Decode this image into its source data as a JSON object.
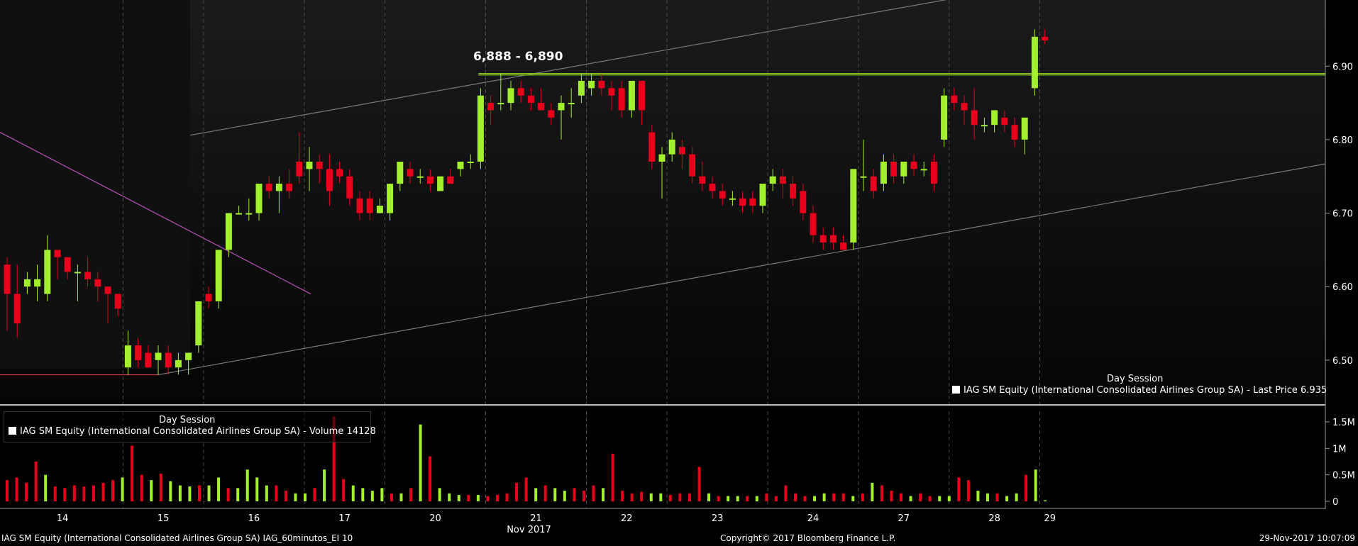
{
  "chart_data": [
    {
      "type": "candlestick",
      "name": "IAG SM Equity (International Consolidated Airlines Group SA) - Last Price 6.935",
      "session_label": "Day Session",
      "ylim": [
        6.44,
        6.99
      ],
      "yticks": [
        "6.50",
        "6.60",
        "6.70",
        "6.80",
        "6.90"
      ],
      "annotation": "6,888 - 6,890",
      "levels": [
        6.888,
        6.89
      ],
      "support": 6.48,
      "candles": [
        [
          6.63,
          6.64,
          6.54,
          6.59
        ],
        [
          6.59,
          6.63,
          6.53,
          6.55
        ],
        [
          6.6,
          6.62,
          6.59,
          6.61
        ],
        [
          6.6,
          6.63,
          6.58,
          6.61
        ],
        [
          6.59,
          6.67,
          6.58,
          6.65
        ],
        [
          6.65,
          6.65,
          6.61,
          6.64
        ],
        [
          6.64,
          6.64,
          6.61,
          6.62
        ],
        [
          6.62,
          6.63,
          6.58,
          6.62
        ],
        [
          6.62,
          6.64,
          6.6,
          6.61
        ],
        [
          6.61,
          6.62,
          6.58,
          6.6
        ],
        [
          6.6,
          6.6,
          6.55,
          6.59
        ],
        [
          6.59,
          6.59,
          6.56,
          6.57
        ],
        [
          6.49,
          6.54,
          6.48,
          6.52
        ],
        [
          6.52,
          6.53,
          6.49,
          6.5
        ],
        [
          6.51,
          6.52,
          6.49,
          6.49
        ],
        [
          6.5,
          6.52,
          6.48,
          6.51
        ],
        [
          6.51,
          6.52,
          6.48,
          6.49
        ],
        [
          6.49,
          6.51,
          6.48,
          6.5
        ],
        [
          6.5,
          6.51,
          6.48,
          6.51
        ],
        [
          6.52,
          6.58,
          6.51,
          6.58
        ],
        [
          6.59,
          6.6,
          6.57,
          6.58
        ],
        [
          6.58,
          6.65,
          6.57,
          6.65
        ],
        [
          6.65,
          6.7,
          6.64,
          6.7
        ],
        [
          6.7,
          6.71,
          6.7,
          6.7
        ],
        [
          6.7,
          6.72,
          6.69,
          6.7
        ],
        [
          6.7,
          6.74,
          6.69,
          6.74
        ],
        [
          6.74,
          6.75,
          6.72,
          6.73
        ],
        [
          6.73,
          6.75,
          6.7,
          6.74
        ],
        [
          6.74,
          6.76,
          6.72,
          6.73
        ],
        [
          6.77,
          6.81,
          6.74,
          6.75
        ],
        [
          6.76,
          6.79,
          6.73,
          6.77
        ],
        [
          6.77,
          6.78,
          6.74,
          6.76
        ],
        [
          6.76,
          6.78,
          6.71,
          6.73
        ],
        [
          6.76,
          6.77,
          6.74,
          6.75
        ],
        [
          6.75,
          6.76,
          6.71,
          6.72
        ],
        [
          6.72,
          6.73,
          6.69,
          6.7
        ],
        [
          6.72,
          6.73,
          6.69,
          6.7
        ],
        [
          6.7,
          6.72,
          6.7,
          6.71
        ],
        [
          6.7,
          6.74,
          6.69,
          6.74
        ],
        [
          6.74,
          6.77,
          6.73,
          6.77
        ],
        [
          6.76,
          6.77,
          6.74,
          6.75
        ],
        [
          6.75,
          6.76,
          6.74,
          6.75
        ],
        [
          6.75,
          6.76,
          6.73,
          6.74
        ],
        [
          6.73,
          6.75,
          6.73,
          6.75
        ],
        [
          6.75,
          6.76,
          6.74,
          6.74
        ],
        [
          6.76,
          6.77,
          6.75,
          6.77
        ],
        [
          6.77,
          6.78,
          6.76,
          6.77
        ],
        [
          6.77,
          6.87,
          6.76,
          6.86
        ],
        [
          6.85,
          6.86,
          6.82,
          6.84
        ],
        [
          6.85,
          6.89,
          6.84,
          6.85
        ],
        [
          6.85,
          6.88,
          6.84,
          6.87
        ],
        [
          6.87,
          6.88,
          6.85,
          6.86
        ],
        [
          6.86,
          6.87,
          6.84,
          6.85
        ],
        [
          6.85,
          6.87,
          6.84,
          6.84
        ],
        [
          6.84,
          6.85,
          6.82,
          6.83
        ],
        [
          6.84,
          6.86,
          6.8,
          6.85
        ],
        [
          6.85,
          6.87,
          6.83,
          6.85
        ],
        [
          6.86,
          6.89,
          6.85,
          6.88
        ],
        [
          6.87,
          6.89,
          6.86,
          6.88
        ],
        [
          6.88,
          6.89,
          6.86,
          6.87
        ],
        [
          6.87,
          6.88,
          6.84,
          6.86
        ],
        [
          6.87,
          6.88,
          6.83,
          6.84
        ],
        [
          6.84,
          6.88,
          6.83,
          6.88
        ],
        [
          6.88,
          6.88,
          6.82,
          6.84
        ],
        [
          6.81,
          6.82,
          6.76,
          6.77
        ],
        [
          6.77,
          6.79,
          6.72,
          6.78
        ],
        [
          6.78,
          6.81,
          6.77,
          6.8
        ],
        [
          6.79,
          6.8,
          6.76,
          6.78
        ],
        [
          6.78,
          6.79,
          6.74,
          6.75
        ],
        [
          6.75,
          6.77,
          6.73,
          6.74
        ],
        [
          6.74,
          6.75,
          6.72,
          6.73
        ],
        [
          6.73,
          6.74,
          6.71,
          6.72
        ],
        [
          6.72,
          6.73,
          6.71,
          6.72
        ],
        [
          6.72,
          6.73,
          6.7,
          6.71
        ],
        [
          6.72,
          6.73,
          6.7,
          6.71
        ],
        [
          6.71,
          6.74,
          6.7,
          6.74
        ],
        [
          6.74,
          6.76,
          6.73,
          6.75
        ],
        [
          6.75,
          6.76,
          6.72,
          6.74
        ],
        [
          6.74,
          6.75,
          6.71,
          6.72
        ],
        [
          6.73,
          6.74,
          6.69,
          6.7
        ],
        [
          6.7,
          6.71,
          6.66,
          6.67
        ],
        [
          6.67,
          6.68,
          6.65,
          6.66
        ],
        [
          6.67,
          6.68,
          6.65,
          6.66
        ],
        [
          6.66,
          6.67,
          6.65,
          6.65
        ],
        [
          6.66,
          6.76,
          6.65,
          6.76
        ],
        [
          6.75,
          6.8,
          6.73,
          6.75
        ],
        [
          6.75,
          6.76,
          6.72,
          6.73
        ],
        [
          6.74,
          6.78,
          6.73,
          6.77
        ],
        [
          6.77,
          6.78,
          6.74,
          6.75
        ],
        [
          6.75,
          6.77,
          6.74,
          6.77
        ],
        [
          6.77,
          6.78,
          6.75,
          6.76
        ],
        [
          6.76,
          6.77,
          6.75,
          6.76
        ],
        [
          6.77,
          6.78,
          6.73,
          6.74
        ],
        [
          6.8,
          6.87,
          6.79,
          6.86
        ],
        [
          6.86,
          6.87,
          6.84,
          6.85
        ],
        [
          6.85,
          6.86,
          6.82,
          6.84
        ],
        [
          6.84,
          6.87,
          6.8,
          6.82
        ],
        [
          6.82,
          6.83,
          6.81,
          6.82
        ],
        [
          6.82,
          6.84,
          6.81,
          6.84
        ],
        [
          6.83,
          6.84,
          6.81,
          6.82
        ],
        [
          6.82,
          6.83,
          6.79,
          6.8
        ],
        [
          6.8,
          6.83,
          6.78,
          6.83
        ],
        [
          6.87,
          6.95,
          6.86,
          6.94
        ],
        [
          6.94,
          6.95,
          6.93,
          6.935
        ]
      ],
      "days": [
        {
          "label": "14",
          "start": 0,
          "end": 11
        },
        {
          "label": "15",
          "start": 12,
          "end": 19
        },
        {
          "label": "16",
          "start": 20,
          "end": 29
        },
        {
          "label": "17",
          "start": 30,
          "end": 37
        },
        {
          "label": "20",
          "start": 38,
          "end": 47
        },
        {
          "label": "21",
          "start": 48,
          "end": 57
        },
        {
          "label": "22",
          "start": 58,
          "end": 65
        },
        {
          "label": "23",
          "start": 66,
          "end": 75
        },
        {
          "label": "24",
          "start": 76,
          "end": 84
        },
        {
          "label": "27",
          "start": 85,
          "end": 93
        },
        {
          "label": "28",
          "start": 94,
          "end": 102
        },
        {
          "label": "29",
          "start": 103,
          "end": 104
        }
      ],
      "month_label": "Nov 2017",
      "colors": {
        "up": "#a2f02e",
        "down": "#e8001c",
        "grid": "#4a4a4a",
        "level": "#8ac926",
        "channel": "#7a7a7a",
        "trend": "#b94fb7",
        "support": "#d43b5a"
      }
    },
    {
      "type": "bar",
      "name": "IAG SM Equity (International Consolidated Airlines Group SA) - Volume 14128",
      "session_label": "Day Session",
      "ylim": [
        0,
        1.7
      ],
      "yticks": [
        "0",
        "0.5M",
        "1M",
        "1.5M"
      ],
      "values_m": [
        0.4,
        0.45,
        0.35,
        0.75,
        0.5,
        0.28,
        0.25,
        0.3,
        0.28,
        0.3,
        0.35,
        0.4,
        0.45,
        1.05,
        0.5,
        0.4,
        0.52,
        0.38,
        0.3,
        0.28,
        0.3,
        0.3,
        0.45,
        0.25,
        0.25,
        0.6,
        0.45,
        0.3,
        0.3,
        0.2,
        0.15,
        0.15,
        0.25,
        0.6,
        1.6,
        0.42,
        0.3,
        0.25,
        0.2,
        0.25,
        0.15,
        0.15,
        0.25,
        1.45,
        0.85,
        0.25,
        0.15,
        0.12,
        0.12,
        0.12,
        0.1,
        0.12,
        0.15,
        0.35,
        0.45,
        0.25,
        0.3,
        0.25,
        0.2,
        0.25,
        0.2,
        0.3,
        0.25,
        0.9,
        0.2,
        0.15,
        0.18,
        0.15,
        0.15,
        0.12,
        0.15,
        0.15,
        0.65,
        0.15,
        0.1,
        0.1,
        0.1,
        0.1,
        0.1,
        0.15,
        0.1,
        0.3,
        0.15,
        0.1,
        0.1,
        0.15,
        0.15,
        0.15,
        0.1,
        0.15,
        0.35,
        0.3,
        0.2,
        0.15,
        0.1,
        0.15,
        0.1,
        0.1,
        0.1,
        0.45,
        0.4,
        0.2,
        0.15,
        0.15,
        0.1,
        0.15,
        0.5,
        0.6,
        0.02
      ],
      "up_flags": [
        0,
        0,
        0,
        0,
        1,
        0,
        0,
        0,
        0,
        0,
        0,
        0,
        1,
        0,
        0,
        1,
        0,
        1,
        1,
        1,
        0,
        1,
        1,
        0,
        1,
        1,
        1,
        1,
        0,
        0,
        1,
        1,
        0,
        1,
        0,
        0,
        1,
        1,
        1,
        1,
        0,
        1,
        0,
        1,
        0,
        1,
        1,
        1,
        0,
        1,
        0,
        0,
        0,
        0,
        0,
        1,
        0,
        1,
        1,
        0,
        0,
        0,
        1,
        0,
        0,
        0,
        0,
        1,
        1,
        0,
        0,
        0,
        0,
        1,
        0,
        1,
        1,
        0,
        1,
        0,
        0,
        0,
        0,
        0,
        1,
        1,
        0,
        0,
        1,
        0,
        1,
        0,
        0,
        0,
        1,
        0,
        0,
        1,
        1,
        0,
        0,
        1,
        1,
        0,
        1,
        1,
        0,
        1,
        1,
        1,
        1,
        0
      ]
    }
  ],
  "footer": {
    "left": "IAG SM Equity (International Consolidated Airlines Group SA) IAG_60minutos_EI 10",
    "center": "Copyright© 2017 Bloomberg Finance L.P.",
    "right": "29-Nov-2017 10:07:09"
  }
}
